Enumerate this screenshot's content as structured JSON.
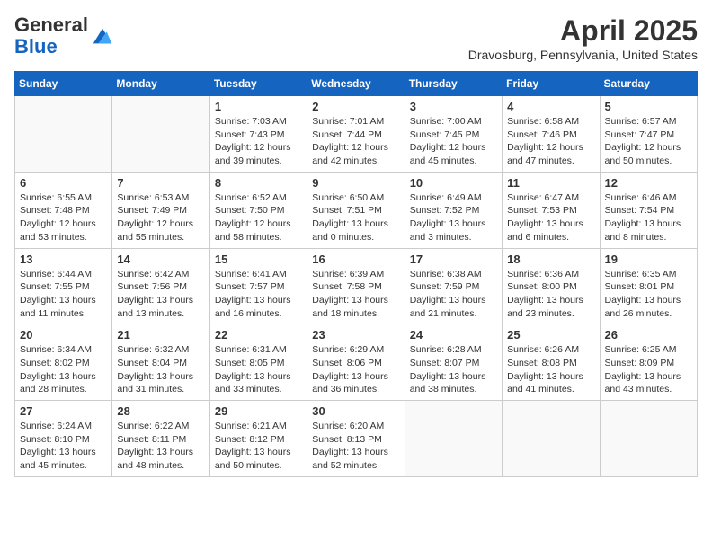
{
  "header": {
    "logo_general": "General",
    "logo_blue": "Blue",
    "month_title": "April 2025",
    "location": "Dravosburg, Pennsylvania, United States"
  },
  "days_of_week": [
    "Sunday",
    "Monday",
    "Tuesday",
    "Wednesday",
    "Thursday",
    "Friday",
    "Saturday"
  ],
  "weeks": [
    [
      {
        "day": "",
        "info": ""
      },
      {
        "day": "",
        "info": ""
      },
      {
        "day": "1",
        "info": "Sunrise: 7:03 AM\nSunset: 7:43 PM\nDaylight: 12 hours and 39 minutes."
      },
      {
        "day": "2",
        "info": "Sunrise: 7:01 AM\nSunset: 7:44 PM\nDaylight: 12 hours and 42 minutes."
      },
      {
        "day": "3",
        "info": "Sunrise: 7:00 AM\nSunset: 7:45 PM\nDaylight: 12 hours and 45 minutes."
      },
      {
        "day": "4",
        "info": "Sunrise: 6:58 AM\nSunset: 7:46 PM\nDaylight: 12 hours and 47 minutes."
      },
      {
        "day": "5",
        "info": "Sunrise: 6:57 AM\nSunset: 7:47 PM\nDaylight: 12 hours and 50 minutes."
      }
    ],
    [
      {
        "day": "6",
        "info": "Sunrise: 6:55 AM\nSunset: 7:48 PM\nDaylight: 12 hours and 53 minutes."
      },
      {
        "day": "7",
        "info": "Sunrise: 6:53 AM\nSunset: 7:49 PM\nDaylight: 12 hours and 55 minutes."
      },
      {
        "day": "8",
        "info": "Sunrise: 6:52 AM\nSunset: 7:50 PM\nDaylight: 12 hours and 58 minutes."
      },
      {
        "day": "9",
        "info": "Sunrise: 6:50 AM\nSunset: 7:51 PM\nDaylight: 13 hours and 0 minutes."
      },
      {
        "day": "10",
        "info": "Sunrise: 6:49 AM\nSunset: 7:52 PM\nDaylight: 13 hours and 3 minutes."
      },
      {
        "day": "11",
        "info": "Sunrise: 6:47 AM\nSunset: 7:53 PM\nDaylight: 13 hours and 6 minutes."
      },
      {
        "day": "12",
        "info": "Sunrise: 6:46 AM\nSunset: 7:54 PM\nDaylight: 13 hours and 8 minutes."
      }
    ],
    [
      {
        "day": "13",
        "info": "Sunrise: 6:44 AM\nSunset: 7:55 PM\nDaylight: 13 hours and 11 minutes."
      },
      {
        "day": "14",
        "info": "Sunrise: 6:42 AM\nSunset: 7:56 PM\nDaylight: 13 hours and 13 minutes."
      },
      {
        "day": "15",
        "info": "Sunrise: 6:41 AM\nSunset: 7:57 PM\nDaylight: 13 hours and 16 minutes."
      },
      {
        "day": "16",
        "info": "Sunrise: 6:39 AM\nSunset: 7:58 PM\nDaylight: 13 hours and 18 minutes."
      },
      {
        "day": "17",
        "info": "Sunrise: 6:38 AM\nSunset: 7:59 PM\nDaylight: 13 hours and 21 minutes."
      },
      {
        "day": "18",
        "info": "Sunrise: 6:36 AM\nSunset: 8:00 PM\nDaylight: 13 hours and 23 minutes."
      },
      {
        "day": "19",
        "info": "Sunrise: 6:35 AM\nSunset: 8:01 PM\nDaylight: 13 hours and 26 minutes."
      }
    ],
    [
      {
        "day": "20",
        "info": "Sunrise: 6:34 AM\nSunset: 8:02 PM\nDaylight: 13 hours and 28 minutes."
      },
      {
        "day": "21",
        "info": "Sunrise: 6:32 AM\nSunset: 8:04 PM\nDaylight: 13 hours and 31 minutes."
      },
      {
        "day": "22",
        "info": "Sunrise: 6:31 AM\nSunset: 8:05 PM\nDaylight: 13 hours and 33 minutes."
      },
      {
        "day": "23",
        "info": "Sunrise: 6:29 AM\nSunset: 8:06 PM\nDaylight: 13 hours and 36 minutes."
      },
      {
        "day": "24",
        "info": "Sunrise: 6:28 AM\nSunset: 8:07 PM\nDaylight: 13 hours and 38 minutes."
      },
      {
        "day": "25",
        "info": "Sunrise: 6:26 AM\nSunset: 8:08 PM\nDaylight: 13 hours and 41 minutes."
      },
      {
        "day": "26",
        "info": "Sunrise: 6:25 AM\nSunset: 8:09 PM\nDaylight: 13 hours and 43 minutes."
      }
    ],
    [
      {
        "day": "27",
        "info": "Sunrise: 6:24 AM\nSunset: 8:10 PM\nDaylight: 13 hours and 45 minutes."
      },
      {
        "day": "28",
        "info": "Sunrise: 6:22 AM\nSunset: 8:11 PM\nDaylight: 13 hours and 48 minutes."
      },
      {
        "day": "29",
        "info": "Sunrise: 6:21 AM\nSunset: 8:12 PM\nDaylight: 13 hours and 50 minutes."
      },
      {
        "day": "30",
        "info": "Sunrise: 6:20 AM\nSunset: 8:13 PM\nDaylight: 13 hours and 52 minutes."
      },
      {
        "day": "",
        "info": ""
      },
      {
        "day": "",
        "info": ""
      },
      {
        "day": "",
        "info": ""
      }
    ]
  ]
}
